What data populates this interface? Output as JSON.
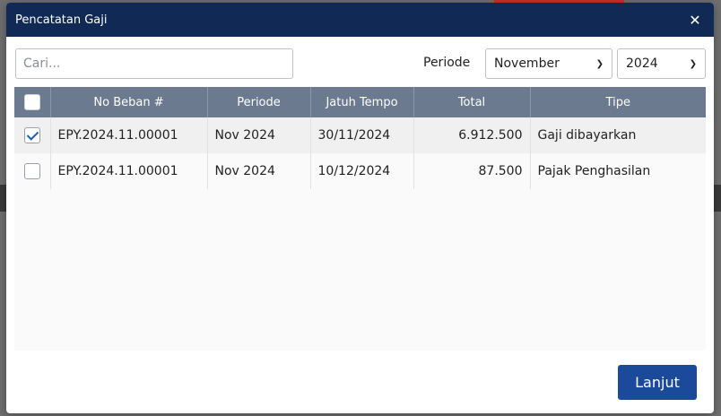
{
  "modal": {
    "title": "Pencatatan Gaji",
    "close_glyph": "✕"
  },
  "search": {
    "placeholder": "Cari..."
  },
  "filter": {
    "periode_label": "Periode",
    "month": "November",
    "year": "2024"
  },
  "table": {
    "headers": [
      "No Beban #",
      "Periode",
      "Jatuh Tempo",
      "Total",
      "Tipe"
    ],
    "rows": [
      {
        "checked": true,
        "no_beban": "EPY.2024.11.00001",
        "periode": "Nov 2024",
        "jatuh_tempo": "30/11/2024",
        "total": "6.912.500",
        "tipe": "Gaji dibayarkan"
      },
      {
        "checked": false,
        "no_beban": "EPY.2024.11.00001",
        "periode": "Nov 2024",
        "jatuh_tempo": "10/12/2024",
        "total": "87.500",
        "tipe": "Pajak Penghasilan"
      }
    ]
  },
  "footer": {
    "next_label": "Lanjut"
  },
  "colors": {
    "header_bg": "#102a55",
    "table_header_bg": "#6b7a8f",
    "primary_button": "#1b4a9a"
  }
}
